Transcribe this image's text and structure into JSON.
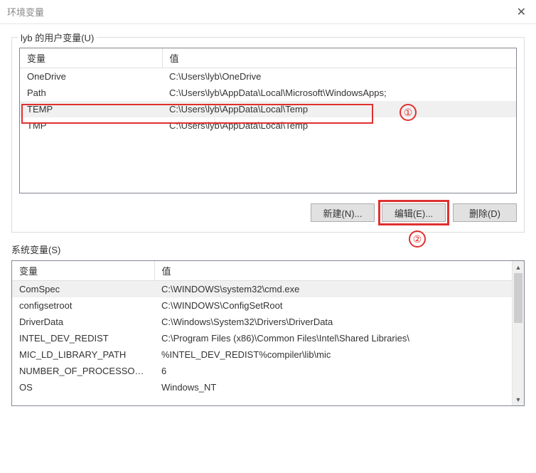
{
  "window": {
    "title": "环境变量"
  },
  "annotations": {
    "row_num": "①",
    "btn_num": "②"
  },
  "user": {
    "legend": "lyb 的用户变量(U)",
    "header_var": "变量",
    "header_val": "值",
    "rows": [
      {
        "var": "OneDrive",
        "val": "C:\\Users\\lyb\\OneDrive"
      },
      {
        "var": "Path",
        "val": "C:\\Users\\lyb\\AppData\\Local\\Microsoft\\WindowsApps;"
      },
      {
        "var": "TEMP",
        "val": "C:\\Users\\lyb\\AppData\\Local\\Temp"
      },
      {
        "var": "TMP",
        "val": "C:\\Users\\lyb\\AppData\\Local\\Temp"
      }
    ],
    "buttons": {
      "new": "新建(N)...",
      "edit": "编辑(E)...",
      "delete": "删除(D)"
    }
  },
  "system": {
    "legend": "系统变量(S)",
    "header_var": "变量",
    "header_val": "值",
    "rows": [
      {
        "var": "ComSpec",
        "val": "C:\\WINDOWS\\system32\\cmd.exe"
      },
      {
        "var": "configsetroot",
        "val": "C:\\WINDOWS\\ConfigSetRoot"
      },
      {
        "var": "DriverData",
        "val": "C:\\Windows\\System32\\Drivers\\DriverData"
      },
      {
        "var": "INTEL_DEV_REDIST",
        "val": "C:\\Program Files (x86)\\Common Files\\Intel\\Shared Libraries\\"
      },
      {
        "var": "MIC_LD_LIBRARY_PATH",
        "val": "%INTEL_DEV_REDIST%compiler\\lib\\mic"
      },
      {
        "var": "NUMBER_OF_PROCESSORS",
        "val": "6"
      },
      {
        "var": "OS",
        "val": "Windows_NT"
      }
    ]
  }
}
